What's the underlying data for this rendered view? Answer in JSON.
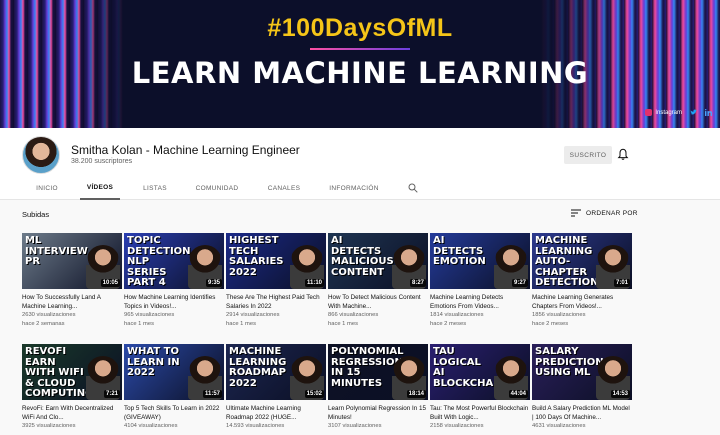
{
  "banner": {
    "hashtag": "#100DaysOfML",
    "title": "LEARN MACHINE LEARNING",
    "links": [
      {
        "label": "Instagram",
        "icon": "instagram-icon",
        "color": "#e1306c"
      },
      {
        "label": "",
        "icon": "twitter-icon",
        "color": "#1da1f2"
      },
      {
        "label": "",
        "icon": "linkedin-icon",
        "color": "#0a66c2"
      }
    ]
  },
  "channel": {
    "name": "Smitha Kolan - Machine Learning Engineer",
    "subscribers": "38.200 suscriptores",
    "subscribed_label": "SUSCRITO"
  },
  "tabs": [
    "INICIO",
    "VÍDEOS",
    "LISTAS",
    "COMUNIDAD",
    "CANALES",
    "INFORMACIÓN"
  ],
  "active_tab": "VÍDEOS",
  "section": {
    "title": "Subidas",
    "sort_label": "ORDENAR POR"
  },
  "videos": [
    {
      "thumb_text": "ML INTERVIEW PR",
      "thumb_color": "#6d7b8a",
      "duration": "10:05",
      "title": "How To Successfully Land A Machine Learning...",
      "views": "2630 visualizaciones",
      "age": "hace 2 semanas"
    },
    {
      "thumb_text": "TOPIC DETECTION NLP SERIES PART 4",
      "thumb_color": "#2a3eb1",
      "duration": "9:35",
      "title": "How Machine Learning Identifies Topics in Videos!...",
      "views": "965 visualizaciones",
      "age": "hace 1 mes"
    },
    {
      "thumb_text": "HIGHEST TECH SALARIES 2022",
      "thumb_color": "#1b2a88",
      "duration": "11:10",
      "title": "These Are The Highest Paid Tech Salaries In 2022",
      "views": "2914 visualizaciones",
      "age": "hace 1 mes"
    },
    {
      "thumb_text": "AI DETECTS MALICIOUS CONTENT",
      "thumb_color": "#1f3552",
      "duration": "8:27",
      "title": "How To Detect Malicious Content With Machine...",
      "views": "866 visualizaciones",
      "age": "hace 1 mes"
    },
    {
      "thumb_text": "AI DETECTS EMOTION",
      "thumb_color": "#243b9a",
      "duration": "9:27",
      "title": "Machine Learning Detects Emotions From Videos...",
      "views": "1814 visualizaciones",
      "age": "hace 2 meses"
    },
    {
      "thumb_text": "MACHINE LEARNING AUTO-CHAPTER DETECTION",
      "thumb_color": "#2d3a8f",
      "duration": "7:01",
      "title": "Machine Learning Generates Chapters From Videos!...",
      "views": "1856 visualizaciones",
      "age": "hace 2 meses"
    },
    {
      "thumb_text": "REVOFI EARN WITH WIFI & CLOUD COMPUTING",
      "thumb_color": "#1a3a2a",
      "duration": "7:21",
      "title": "RevoFi: Earn With Decentralized WiFi And Clo...",
      "views": "3925 visualizaciones",
      "age": ""
    },
    {
      "thumb_text": "WHAT TO LEARN IN 2022",
      "thumb_color": "#2b4aa8",
      "duration": "11:57",
      "title": "Top 5 Tech Skills To Learn in 2022 (GIVEAWAY)",
      "views": "4104 visualizaciones",
      "age": ""
    },
    {
      "thumb_text": "MACHINE LEARNING ROADMAP 2022",
      "thumb_color": "#1c2650",
      "duration": "15:02",
      "title": "Ultimate Machine Learning Roadmap 2022 (HUGE...",
      "views": "14.593 visualizaciones",
      "age": ""
    },
    {
      "thumb_text": "POLYNOMIAL REGRESSION IN 15 MINUTES",
      "thumb_color": "#0e1226",
      "duration": "18:14",
      "title": "Learn Polynomial Regression In 15 Minutes!",
      "views": "3107 visualizaciones",
      "age": ""
    },
    {
      "thumb_text": "TAU LOGICAL AI BLOCKCHAIN",
      "thumb_color": "#2a1f70",
      "duration": "44:04",
      "title": "Tau: The Most Powerful Blockchain Built With Logic...",
      "views": "2158 visualizaciones",
      "age": ""
    },
    {
      "thumb_text": "SALARY PREDICTION USING ML",
      "thumb_color": "#2a1f5a",
      "duration": "14:53",
      "title": "Build A Salary Prediction ML Model | 100 Days Of Machine...",
      "views": "4631 visualizaciones",
      "age": ""
    }
  ],
  "colors": {
    "accent_text": "#f5c518",
    "thumb_text_highlight": "#ffe14d"
  }
}
